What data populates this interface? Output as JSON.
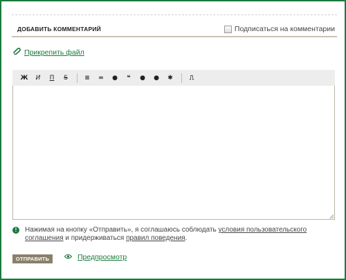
{
  "header": {
    "title": "ДОБАВИТЬ КОММЕНТАРИЙ",
    "subscribe_label": "Подписаться на комментарии"
  },
  "attach": {
    "label": "Прикрепить файл",
    "icon": "paperclip-icon"
  },
  "toolbar": {
    "buttons": [
      {
        "name": "bold",
        "glyph": "Ж"
      },
      {
        "name": "italic",
        "glyph": "И"
      },
      {
        "name": "underline",
        "glyph": "П"
      },
      {
        "name": "strikethrough",
        "glyph": "S"
      },
      {
        "name": "list",
        "glyph": "≡"
      },
      {
        "name": "link",
        "glyph": "∞"
      },
      {
        "name": "spoiler",
        "glyph": "●"
      },
      {
        "name": "quote",
        "glyph": "❝"
      },
      {
        "name": "speech",
        "glyph": "●"
      },
      {
        "name": "comment",
        "glyph": "●"
      },
      {
        "name": "image",
        "glyph": "✱"
      },
      {
        "name": "cut",
        "glyph": "⎍"
      }
    ]
  },
  "notice": {
    "icon": "exclamation-icon",
    "text_before": "Нажимая на кнопку «Отправить», я соглашаюсь соблюдать ",
    "terms_link": "условия пользовательского соглашения",
    "text_middle": " и придерживаться ",
    "rules_link": "правил поведения",
    "text_after": "."
  },
  "actions": {
    "submit_label": "ОТПРАВИТЬ",
    "preview_label": "Предпросмотр",
    "preview_icon": "eye-icon"
  },
  "colors": {
    "accent": "#1a7a3a",
    "button": "#8a806a"
  }
}
